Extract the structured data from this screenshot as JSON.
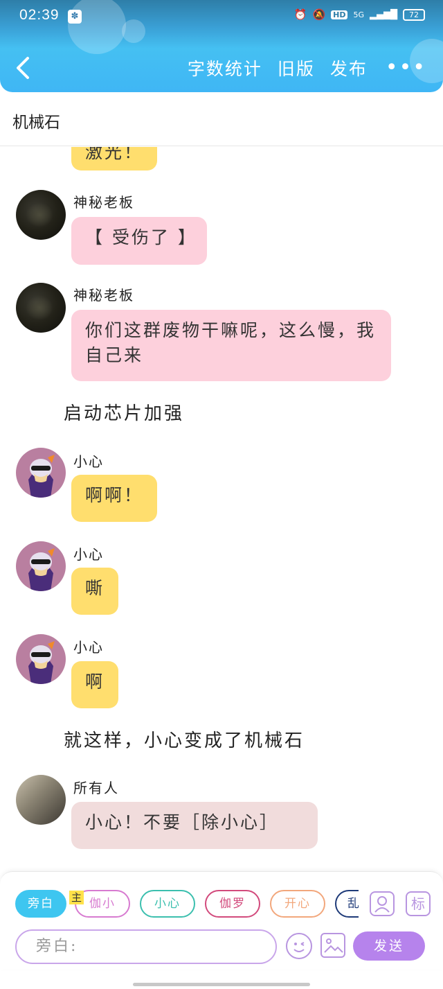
{
  "status_bar": {
    "time": "02:39",
    "battery": "72",
    "network": "5G",
    "hd": "HD"
  },
  "header": {
    "word_count_label": "字数统计",
    "old_version_label": "旧版",
    "publish_label": "发布",
    "more_label": "•••"
  },
  "page_title": "机械石",
  "messages": [
    {
      "type": "bubble",
      "text": "激光！",
      "color": "#ffde6e"
    },
    {
      "type": "bubble",
      "speaker": "神秘老板",
      "text": "【 受伤了 】",
      "color": "#fdd0dc"
    },
    {
      "type": "bubble",
      "speaker": "神秘老板",
      "text": "你们这群废物干嘛呢，这么慢，我自己来",
      "color": "#fdd0dc"
    },
    {
      "type": "narration",
      "text": "启动芯片加强"
    },
    {
      "type": "bubble",
      "speaker": "小心",
      "text": "啊啊！",
      "color": "#ffde6e"
    },
    {
      "type": "bubble",
      "speaker": "小心",
      "text": "嘶",
      "color": "#ffde6e"
    },
    {
      "type": "bubble",
      "speaker": "小心",
      "text": "啊",
      "color": "#ffde6e"
    },
    {
      "type": "narration",
      "text": "就这样，小心变成了机械石"
    },
    {
      "type": "bubble",
      "speaker": "所有人",
      "text": "小心！不要［除小心］",
      "color": "#f1dcdc"
    }
  ],
  "composer": {
    "role_chips": [
      {
        "label": "旁白",
        "color": "#3ec6f0"
      },
      {
        "label": "伽小",
        "color": "#d77ad0"
      },
      {
        "label": "小心",
        "color": "#3bbfae"
      },
      {
        "label": "伽罗",
        "color": "#d24a7c"
      },
      {
        "label": "开心",
        "color": "#f2a77c"
      },
      {
        "label": "乱",
        "color": "#1e3a78"
      }
    ],
    "main_tag": "主",
    "mark_label": "标",
    "input_placeholder": "旁白:",
    "send_label": "发送"
  }
}
